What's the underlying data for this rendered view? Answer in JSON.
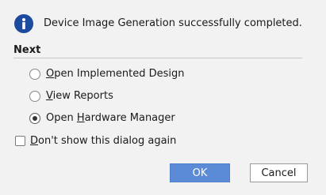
{
  "icon": {
    "name": "info-icon",
    "color": "#1c4a9e"
  },
  "message": "Device Image Generation successfully completed.",
  "section": {
    "title": "Next"
  },
  "options": [
    {
      "mnemonic": "O",
      "rest": "pen Implemented Design",
      "checked": false
    },
    {
      "mnemonic": "V",
      "rest": "iew Reports",
      "checked": false
    },
    {
      "prefix": "Open ",
      "mnemonic": "H",
      "rest": "ardware Manager",
      "checked": true
    }
  ],
  "dont_show": {
    "mnemonic": "D",
    "rest": "on't show this dialog again",
    "checked": false
  },
  "buttons": {
    "ok": "OK",
    "cancel": "Cancel",
    "ok_color": "#5b8ad6"
  }
}
